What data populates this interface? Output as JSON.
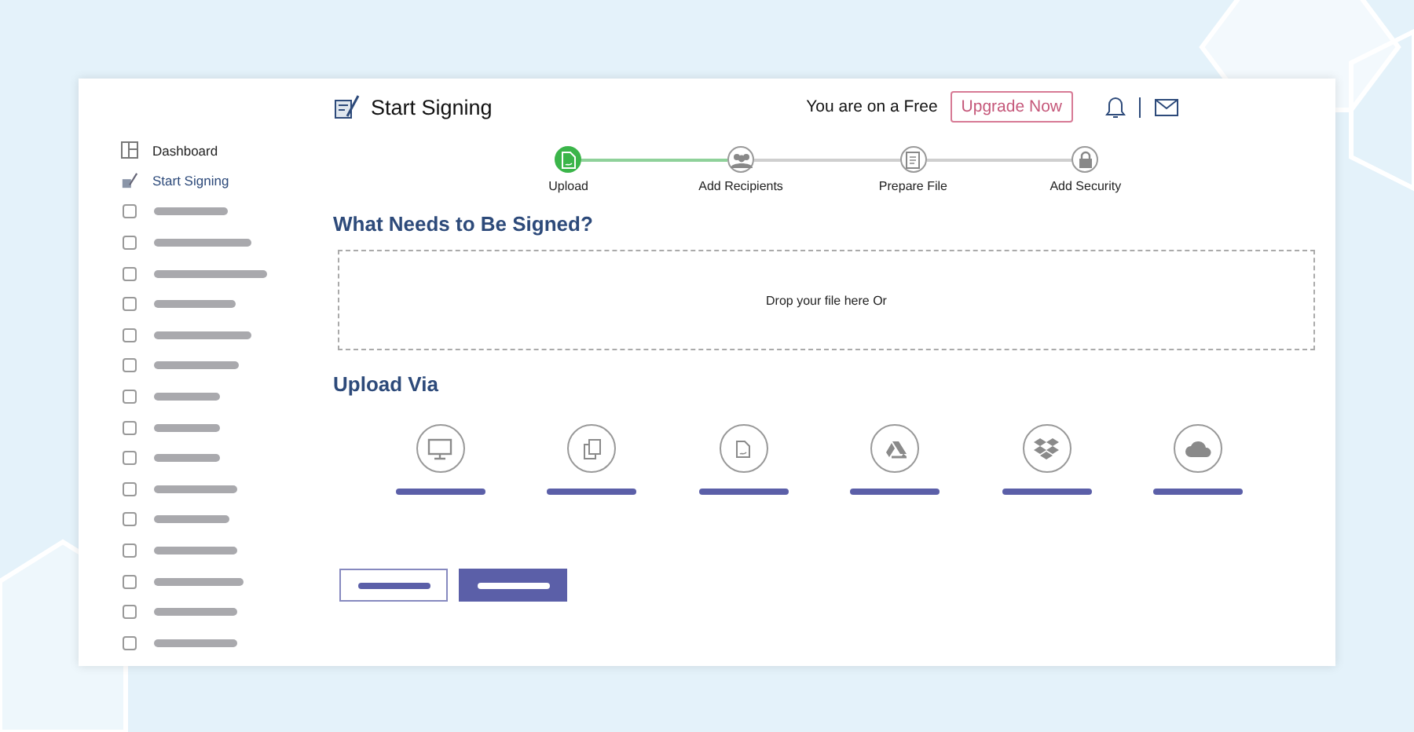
{
  "header": {
    "title": "Start Signing",
    "plan_text": "You are on a Free",
    "upgrade_button": "Upgrade Now"
  },
  "sidebar": {
    "items": [
      {
        "kind": "link",
        "label": "Dashboard",
        "selected": false
      },
      {
        "kind": "link",
        "label": "Start Signing",
        "selected": true
      },
      {
        "kind": "placeholder"
      },
      {
        "kind": "placeholder"
      },
      {
        "kind": "placeholder"
      },
      {
        "kind": "placeholder"
      },
      {
        "kind": "placeholder"
      },
      {
        "kind": "placeholder"
      },
      {
        "kind": "placeholder"
      },
      {
        "kind": "placeholder"
      },
      {
        "kind": "placeholder"
      },
      {
        "kind": "placeholder"
      },
      {
        "kind": "placeholder"
      },
      {
        "kind": "placeholder"
      },
      {
        "kind": "placeholder"
      },
      {
        "kind": "placeholder"
      },
      {
        "kind": "placeholder"
      }
    ]
  },
  "steps": [
    {
      "label": "Upload",
      "kind": "file",
      "done": true
    },
    {
      "label": "Add Recipients",
      "kind": "people",
      "done": false
    },
    {
      "label": "Prepare File",
      "kind": "document",
      "done": false
    },
    {
      "label": "Add Security",
      "kind": "lock",
      "done": false
    }
  ],
  "heading": "What Needs to Be Signed?",
  "dropzone": {
    "text": "Drop your file here Or"
  },
  "upload_via": {
    "heading": "Upload Via",
    "sources": [
      {
        "kind": "monitor"
      },
      {
        "kind": "copy"
      },
      {
        "kind": "file"
      },
      {
        "kind": "drive"
      },
      {
        "kind": "dropbox"
      },
      {
        "kind": "cloud"
      }
    ]
  },
  "actions": [
    {
      "kind": "outline"
    },
    {
      "kind": "filled"
    }
  ]
}
